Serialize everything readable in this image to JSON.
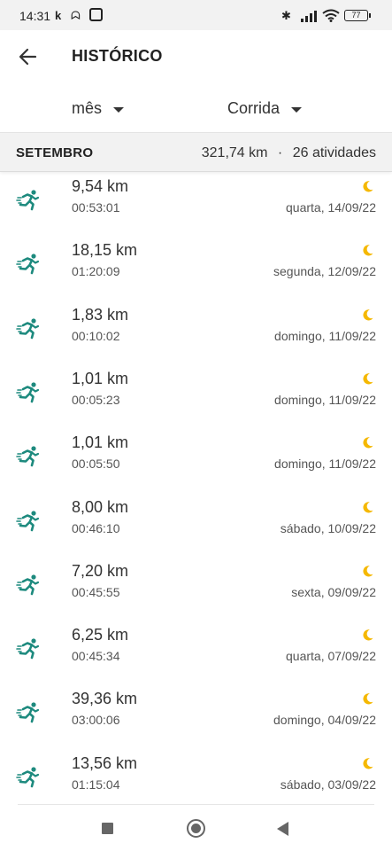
{
  "status_bar": {
    "time": "14:31",
    "battery": "77"
  },
  "header": {
    "title": "HISTÓRICO"
  },
  "filters": {
    "period": "mês",
    "activity": "Corrida"
  },
  "month_section": {
    "month": "SETEMBRO",
    "total_distance": "321,74 km",
    "separator": "·",
    "activity_count": "26 atividades"
  },
  "colors": {
    "accent": "#1d8a7e",
    "moon": "#f5b800"
  },
  "activities": [
    {
      "distance": "9,54 km",
      "duration": "00:53:01",
      "date": "quarta, 14/09/22"
    },
    {
      "distance": "18,15 km",
      "duration": "01:20:09",
      "date": "segunda, 12/09/22"
    },
    {
      "distance": "1,83 km",
      "duration": "00:10:02",
      "date": "domingo, 11/09/22"
    },
    {
      "distance": "1,01 km",
      "duration": "00:05:23",
      "date": "domingo, 11/09/22"
    },
    {
      "distance": "1,01 km",
      "duration": "00:05:50",
      "date": "domingo, 11/09/22"
    },
    {
      "distance": "8,00 km",
      "duration": "00:46:10",
      "date": "sábado, 10/09/22"
    },
    {
      "distance": "7,20 km",
      "duration": "00:45:55",
      "date": "sexta, 09/09/22"
    },
    {
      "distance": "6,25 km",
      "duration": "00:45:34",
      "date": "quarta, 07/09/22"
    },
    {
      "distance": "39,36 km",
      "duration": "03:00:06",
      "date": "domingo, 04/09/22"
    },
    {
      "distance": "13,56 km",
      "duration": "01:15:04",
      "date": "sábado, 03/09/22"
    }
  ]
}
